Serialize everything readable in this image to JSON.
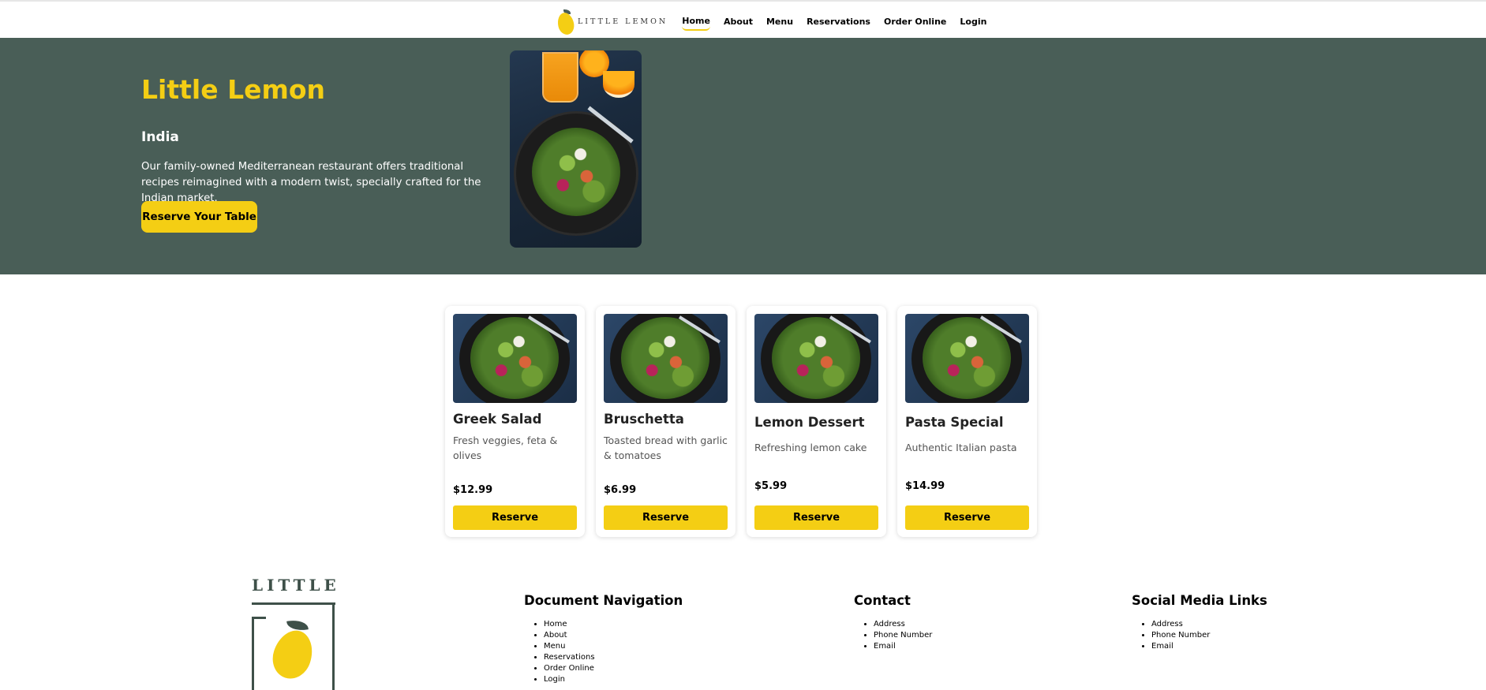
{
  "nav": {
    "brand": "LITTLE LEMON",
    "items": [
      {
        "label": "Home",
        "active": true
      },
      {
        "label": "About"
      },
      {
        "label": "Menu"
      },
      {
        "label": "Reservations"
      },
      {
        "label": "Order Online"
      },
      {
        "label": "Login"
      }
    ]
  },
  "hero": {
    "title": "Little Lemon",
    "subtitle": "India",
    "description": "Our family-owned Mediterranean restaurant offers traditional recipes reimagined with a modern twist, specially crafted for the Indian market.",
    "button_label": "Reserve Your Table"
  },
  "specials": [
    {
      "name": "Greek Salad",
      "description": "Fresh veggies, feta & olives",
      "price": "$12.99",
      "button_label": "Reserve"
    },
    {
      "name": "Bruschetta",
      "description": "Toasted bread with garlic & tomatoes",
      "price": "$6.99",
      "button_label": "Reserve"
    },
    {
      "name": "Lemon Dessert",
      "description": "Refreshing lemon cake",
      "price": "$5.99",
      "button_label": "Reserve"
    },
    {
      "name": "Pasta Special",
      "description": "Authentic Italian pasta",
      "price": "$14.99",
      "button_label": "Reserve"
    }
  ],
  "footer": {
    "logo_text": "LITTLE",
    "navigation": {
      "title": "Document Navigation",
      "items": [
        "Home",
        "About",
        "Menu",
        "Reservations",
        "Order Online",
        "Login"
      ]
    },
    "contact": {
      "title": "Contact",
      "items": [
        "Address",
        "Phone Number",
        "Email"
      ]
    },
    "social": {
      "title": "Social Media Links",
      "items": [
        "Address",
        "Phone Number",
        "Email"
      ]
    }
  },
  "colors": {
    "primary_green": "#495e57",
    "primary_yellow": "#f4ce14",
    "footer_green": "#3e5049"
  }
}
